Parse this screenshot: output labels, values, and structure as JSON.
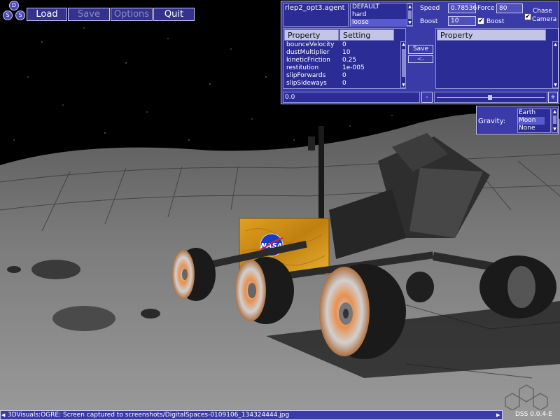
{
  "toolbar": {
    "logo_letters": [
      "D",
      "S",
      "S"
    ],
    "load_label": "Load",
    "save_label": "Save",
    "options_label": "Options",
    "quit_label": "Quit"
  },
  "agent_panel": {
    "agent_file": "rlep2_opt3.agent",
    "presets": [
      "DEFAULT",
      "hard",
      "loose"
    ],
    "selected_preset": "loose",
    "speed_label": "Speed",
    "speed_value": "0.78536",
    "force_label": "Force",
    "force_value": "80",
    "boost_label": "Boost",
    "boost_value": "10",
    "boost_check_label": "Boost",
    "boost_checked": true,
    "chase_camera_label_1": "Chase",
    "chase_camera_label_2": "Camera",
    "chase_camera_checked": true,
    "property_header": "Property",
    "setting_header": "Setting",
    "properties": [
      {
        "name": "bounceVelocity",
        "value": "0"
      },
      {
        "name": "dustMultiplier",
        "value": "10"
      },
      {
        "name": "kineticFriction",
        "value": "0.25"
      },
      {
        "name": "restitution",
        "value": "1e-005"
      },
      {
        "name": "slipForwards",
        "value": "0"
      },
      {
        "name": "slipSideways",
        "value": "0"
      }
    ],
    "save_button": "Save",
    "back_button": "<-",
    "right_property_header": "Property",
    "bottom_value": "0.0",
    "minus_button": "-",
    "plus_button": "+"
  },
  "gravity_panel": {
    "label": "Gravity:",
    "options": [
      "Earth",
      "Moon",
      "None"
    ],
    "selected": "Moon"
  },
  "status": {
    "message": "3DVisuals:OGRE: Screen captured to screenshots/DigitalSpaces-0109106_134324444.jpg",
    "version": "DSS 0.0.4-E"
  },
  "colors": {
    "panel": "#3a3aa8",
    "panel_border": "#c8c8f0",
    "highlight": "#5a5ad0",
    "ground": "#8a8a8a",
    "sky": "#000000"
  }
}
